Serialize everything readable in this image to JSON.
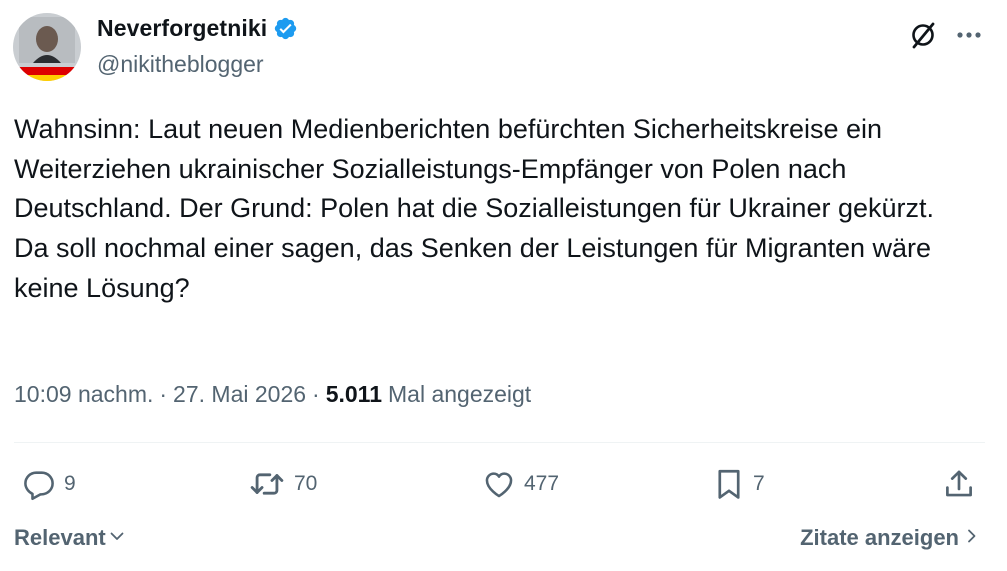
{
  "author": {
    "display_name": "Neverforgetniki",
    "handle": "@nikitheblogger",
    "verified": true
  },
  "icons": {
    "verified": "verified-badge-icon",
    "grok": "grok-icon",
    "more": "more-icon",
    "reply": "reply-icon",
    "repost": "repost-icon",
    "like": "like-icon",
    "bookmark": "bookmark-icon",
    "share": "share-icon"
  },
  "colors": {
    "verified": "#1d9bf0",
    "text": "#0f1419",
    "muted": "#536471"
  },
  "tweet": {
    "text": "Wahnsinn: Laut neuen Medienberichten befürchten Sicherheitskreise ein Weiterziehen ukrainischer Sozialleistungs-Empfänger von Polen nach Deutschland. Der Grund: Polen hat die Sozialleistungen für Ukrainer gekürzt.\nDa soll nochmal einer sagen, das Senken der Leistungen für Migranten wäre keine Lösung?",
    "time": "10:09 nachm.",
    "date": "27. Mai 2026",
    "views_count": "5.011",
    "views_label": "Mal angezeigt"
  },
  "actions": {
    "replies": "9",
    "reposts": "70",
    "likes": "477",
    "bookmarks": "7"
  },
  "footer": {
    "sort_label": "Relevant",
    "quotes_label": "Zitate anzeigen"
  }
}
